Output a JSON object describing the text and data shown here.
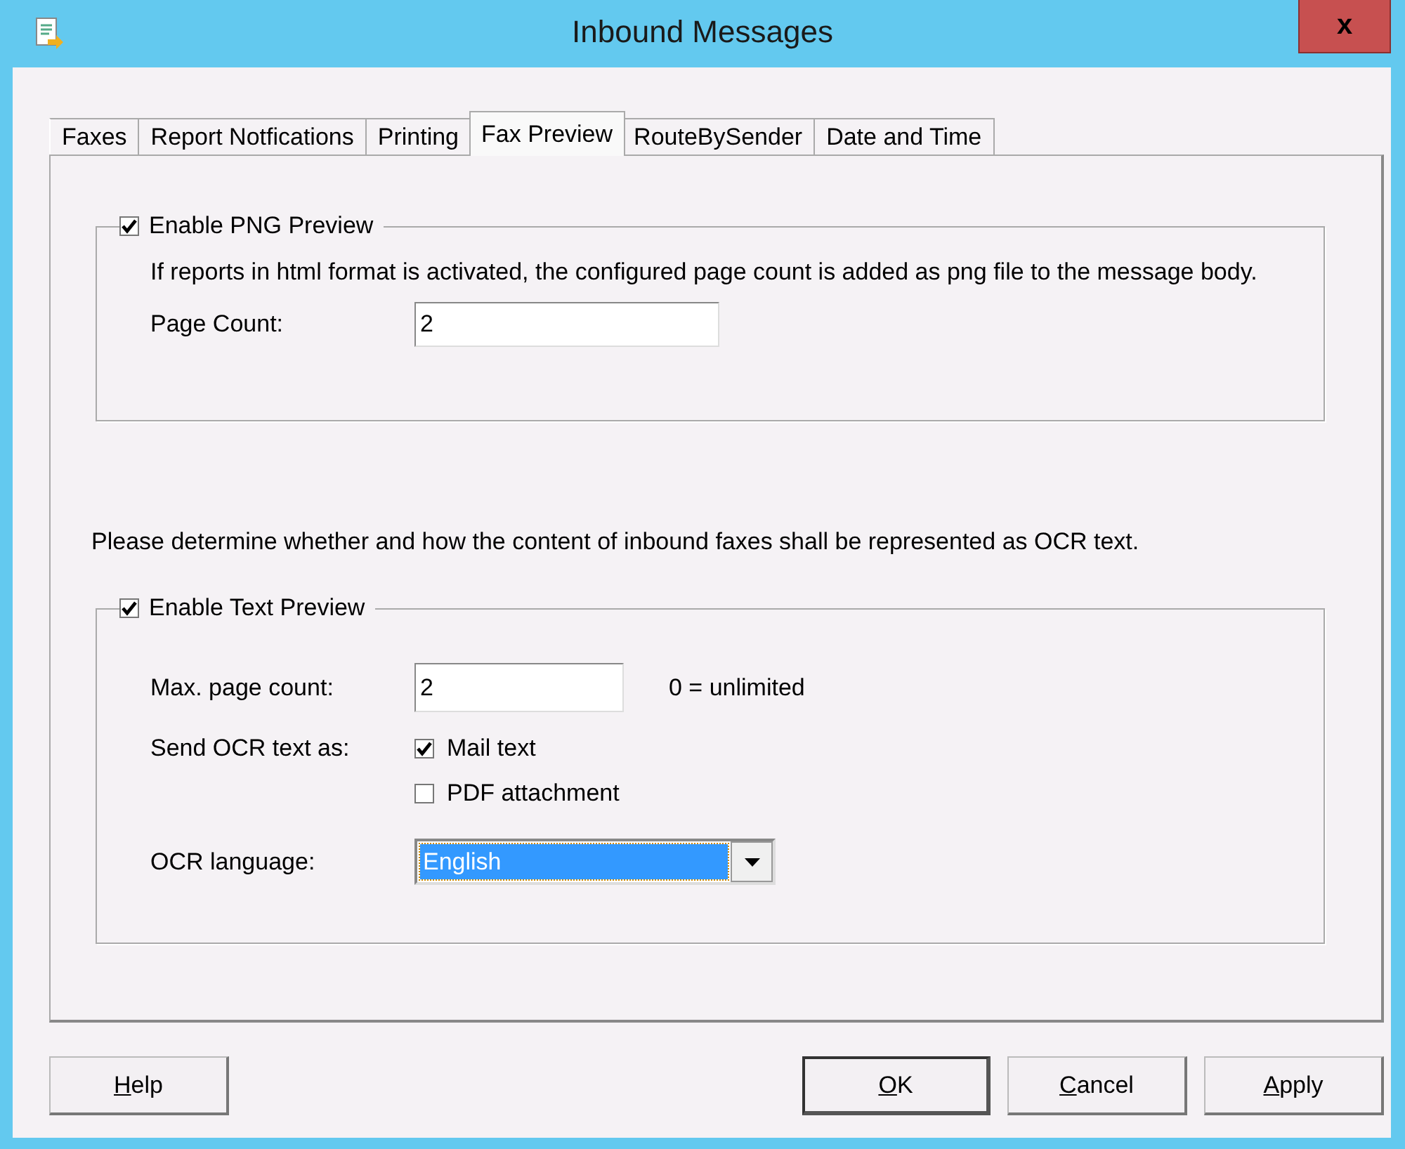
{
  "window": {
    "title": "Inbound Messages",
    "close_label": "x"
  },
  "tabs": [
    {
      "label": "Faxes",
      "selected": false
    },
    {
      "label": "Report Notfications",
      "selected": false
    },
    {
      "label": "Printing",
      "selected": false
    },
    {
      "label": "Fax Preview",
      "selected": true
    },
    {
      "label": "RouteBySender",
      "selected": false
    },
    {
      "label": "Date and Time",
      "selected": false
    }
  ],
  "png_group": {
    "label": "Enable PNG Preview",
    "checked": true,
    "description": "If reports in html format is activated, the configured page count is added as png file to the message body.",
    "page_count": {
      "label": "Page Count:",
      "value": "2"
    }
  },
  "ocr_intro": "Please determine whether and how the content of inbound faxes shall be represented as OCR text.",
  "text_group": {
    "label": "Enable Text Preview",
    "checked": true,
    "max_page_count": {
      "label": "Max. page count:",
      "value": "2",
      "hint": "0 = unlimited"
    },
    "send_as": {
      "label": "Send OCR text as:",
      "options": [
        {
          "label": "Mail text",
          "checked": true
        },
        {
          "label": "PDF attachment",
          "checked": false
        }
      ]
    },
    "language": {
      "label": "OCR language:",
      "value": "English",
      "focused": true
    }
  },
  "buttons": [
    {
      "label": "Help",
      "default": false,
      "access_key_underlined": true
    },
    {
      "label": "OK",
      "default": true,
      "access_key_underlined": true
    },
    {
      "label": "Cancel",
      "default": false,
      "access_key_underlined": true
    },
    {
      "label": "Apply",
      "default": false,
      "access_key_underlined": true
    }
  ]
}
